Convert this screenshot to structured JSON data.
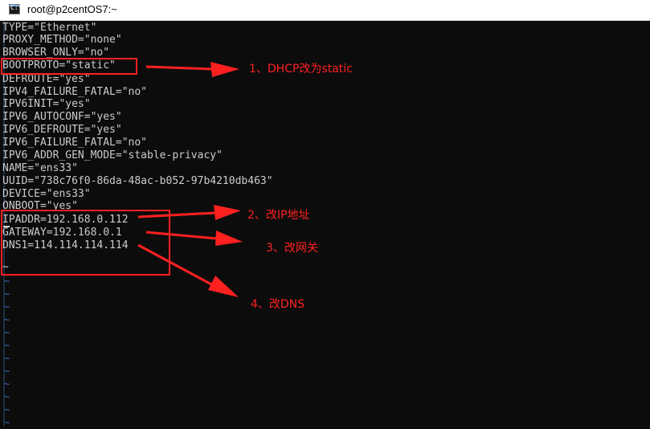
{
  "window": {
    "title": "root@p2centOS7:~",
    "icon": "console-icon"
  },
  "terminal": {
    "lines": [
      "TYPE=\"Ethernet\"",
      "PROXY_METHOD=\"none\"",
      "BROWSER_ONLY=\"no\"",
      "BOOTPROTO=\"static\"",
      "DEFROUTE=\"yes\"",
      "IPV4_FAILURE_FATAL=\"no\"",
      "IPV6INIT=\"yes\"",
      "IPV6_AUTOCONF=\"yes\"",
      "IPV6_DEFROUTE=\"yes\"",
      "IPV6_FAILURE_FATAL=\"no\"",
      "IPV6_ADDR_GEN_MODE=\"stable-privacy\"",
      "NAME=\"ens33\"",
      "UUID=\"738c76f0-86da-48ac-b052-97b4210db463\"",
      "DEVICE=\"ens33\"",
      "ONBOOT=\"yes\"",
      "IPADDR=192.168.0.112",
      "GATEWAY=192.168.0.1",
      "DNS1=114.114.114.114",
      "",
      "~"
    ],
    "tilde": "~",
    "tilde_count": 12
  },
  "annotations": {
    "note1": "1、DHCP改为static",
    "note2": "2、改IP地址",
    "note3": "3、改网关",
    "note4": "4、改DNS",
    "color": "#ff2020"
  }
}
